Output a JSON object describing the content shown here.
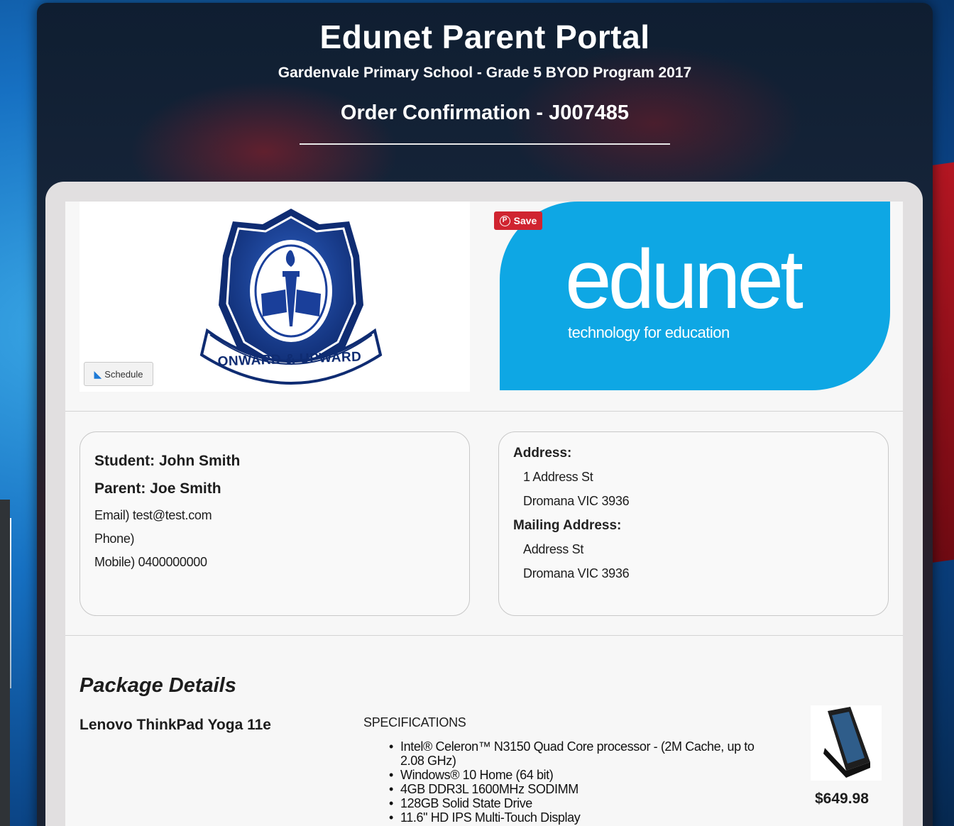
{
  "header": {
    "portal_title": "Edunet Parent Portal",
    "program": "Gardenvale Primary School - Grade 5 BYOD Program 2017",
    "order": "Order Confirmation - J007485"
  },
  "logos": {
    "school_motto": "ONWARD & UPWARD",
    "schedule_label": "Schedule",
    "save_label": "Save",
    "edunet_word": "edunet",
    "edunet_tagline": "technology for education"
  },
  "contact": {
    "student": "Student: John Smith",
    "parent": "Parent: Joe Smith",
    "email": "Email) test@test.com",
    "phone": "Phone)",
    "mobile": "Mobile) 0400000000"
  },
  "address": {
    "label": "Address:",
    "line1": "1 Address St",
    "line2": "Dromana VIC 3936",
    "mailing_label": "Mailing Address:",
    "mailing_line1": "Address St",
    "mailing_line2": "Dromana VIC 3936"
  },
  "package": {
    "title": "Package Details",
    "product_name": "Lenovo ThinkPad Yoga 11e",
    "spec_heading": "SPECIFICATIONS",
    "specs": [
      "Intel® Celeron™ N3150 Quad Core processor - (2M Cache, up to 2.08 GHz)",
      "Windows® 10 Home (64 bit)",
      "4GB DDR3L 1600MHz SODIMM",
      "128GB Solid State Drive",
      "11.6\" HD IPS Multi-Touch Display"
    ],
    "price": "$649.98"
  },
  "colors": {
    "edunet_blue": "#0ea7e4",
    "crest_blue": "#1a3f9a",
    "save_red": "#d02430"
  }
}
